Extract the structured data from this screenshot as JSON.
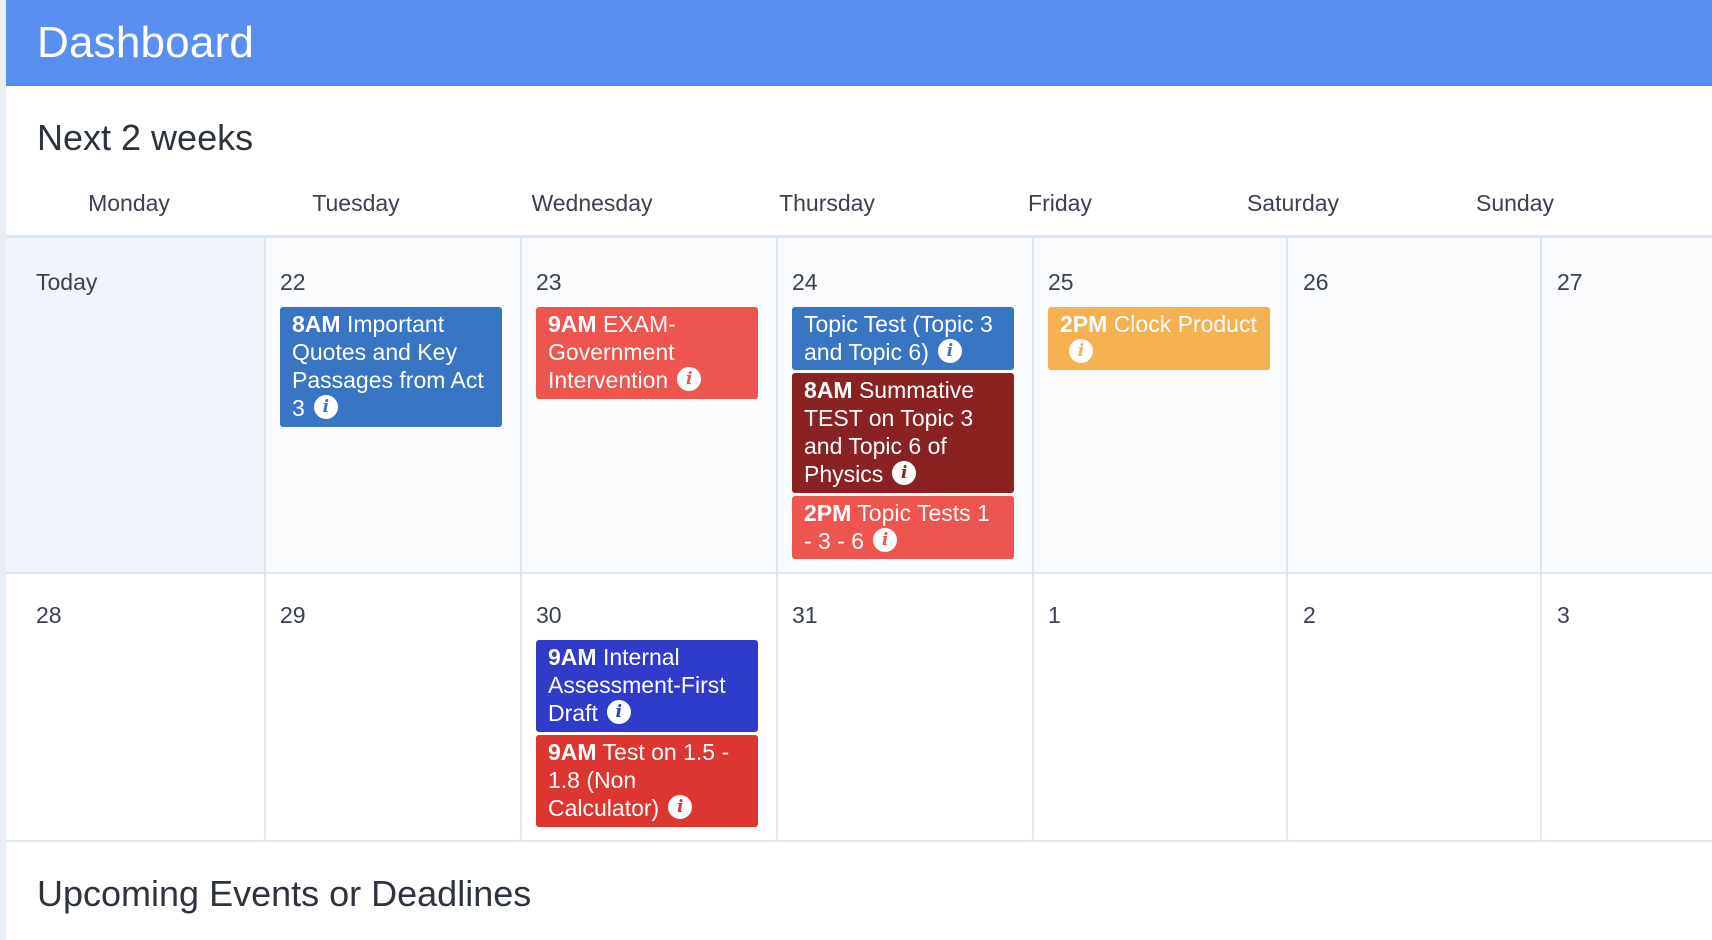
{
  "header": {
    "title": "Dashboard"
  },
  "sections": {
    "next_two_weeks": "Next 2 weeks",
    "upcoming": "Upcoming Events or Deadlines"
  },
  "weekdays": [
    "Monday",
    "Tuesday",
    "Wednesday",
    "Thursday",
    "Friday",
    "Saturday",
    "Sunday"
  ],
  "weeks": [
    {
      "days": [
        "Today",
        "22",
        "23",
        "24",
        "25",
        "26",
        "27"
      ]
    },
    {
      "days": [
        "28",
        "29",
        "30",
        "31",
        "1",
        "2",
        "3"
      ]
    }
  ],
  "events": {
    "e1": {
      "time": "8AM",
      "title": "Important Quotes and Key Passages from Act 3",
      "color": "#3876c4"
    },
    "e2": {
      "time": "9AM",
      "title": "EXAM- Government Intervention",
      "color": "#ee554f"
    },
    "e3": {
      "time": "",
      "title": "Topic Test (Topic 3 and Topic 6)",
      "color": "#3876c4"
    },
    "e4": {
      "time": "8AM",
      "title": "Summative TEST on Topic 3 and Topic 6 of Physics",
      "color": "#8a2222"
    },
    "e5": {
      "time": "2PM",
      "title": "Topic Tests 1 - 3 - 6",
      "color": "#ee554f"
    },
    "e6": {
      "time": "2PM",
      "title": "Clock Product",
      "color": "#f4b051"
    },
    "e7": {
      "time": "9AM",
      "title": "Internal Assessment-First Draft",
      "color": "#2f3bc9"
    },
    "e8": {
      "time": "9AM",
      "title": "Test on 1.5 - 1.8 (Non Calculator)",
      "color": "#dd3530"
    }
  },
  "colors": {
    "header_bg": "#5a8ff2",
    "today_bg": "#f0f5fb",
    "week_bg": "#f9fbfd",
    "grid_line": "#dde8f2"
  },
  "icons": {
    "event_info": "info-icon"
  }
}
